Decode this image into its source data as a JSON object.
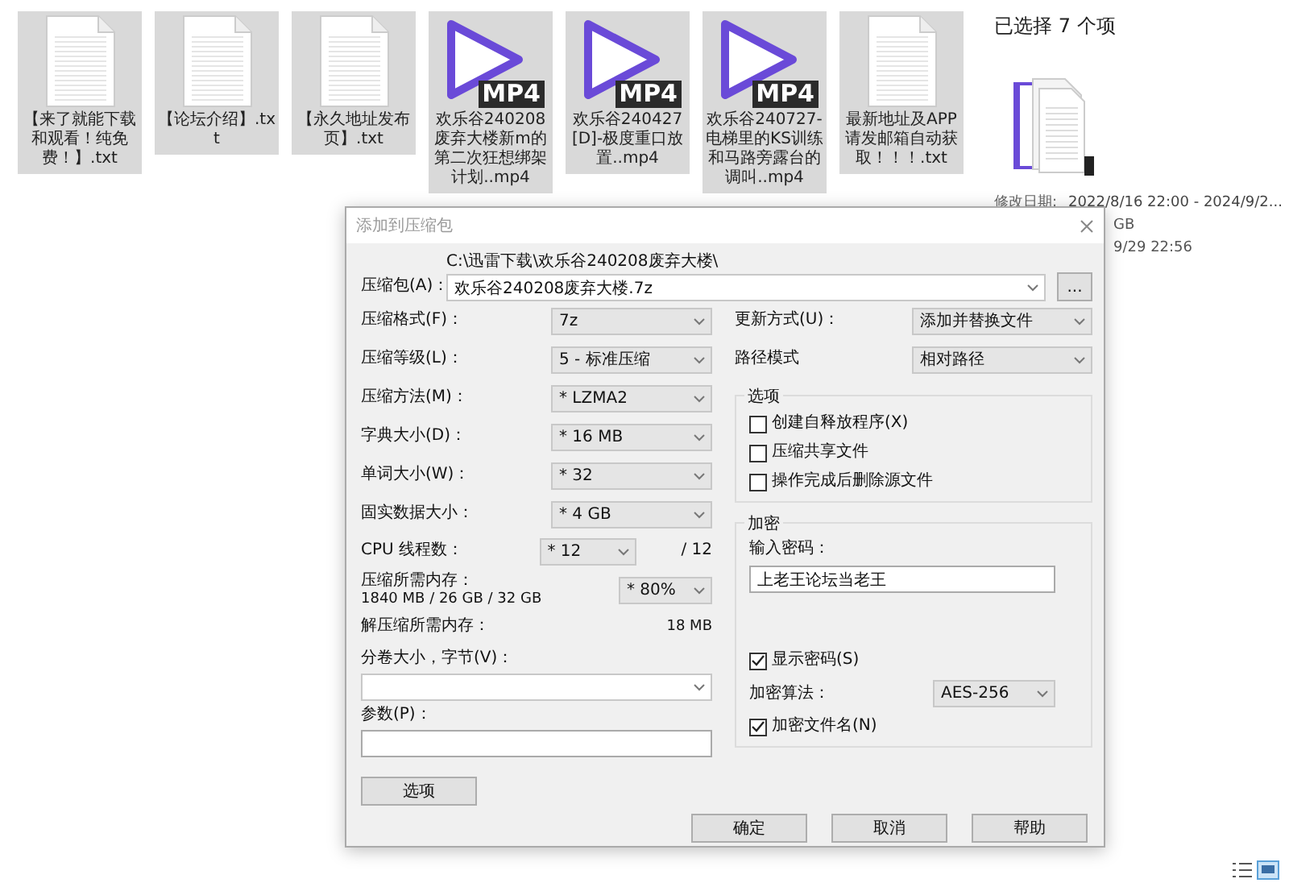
{
  "files": [
    {
      "name": "【来了就能下载和观看！纯免费！】.txt",
      "kind": "text",
      "selected": true
    },
    {
      "name": "【论坛介绍】.txt",
      "kind": "text",
      "selected": true
    },
    {
      "name": "【永久地址发布页】.txt",
      "kind": "text",
      "selected": true
    },
    {
      "name": "欢乐谷240208废弃大楼新m的第二次狂想绑架计划..mp4",
      "kind": "video",
      "badge": "MP4",
      "selected": true
    },
    {
      "name": "欢乐谷240427[D]-极度重口放置..mp4",
      "kind": "video",
      "badge": "MP4",
      "selected": true
    },
    {
      "name": "欢乐谷240727-电梯里的KS训练和马路旁露台的调叫..mp4",
      "kind": "video",
      "badge": "MP4",
      "selected": true
    },
    {
      "name": "最新地址及APP请发邮箱自动获取！！！.txt",
      "kind": "text",
      "selected": true
    }
  ],
  "details": {
    "title": "已选择 7 个项",
    "date_label": "修改日期:",
    "date_value": "2022/8/16 22:00 - 2024/9/2...",
    "line_2": "GB",
    "line_3": "9/29 22:56"
  },
  "dialog": {
    "title": "添加到压缩包",
    "archive": {
      "label": "压缩包(A)：",
      "path": "C:\\迅雷下载\\欢乐谷240208废弃大楼\\",
      "value": "欢乐谷240208废弃大楼.7z",
      "browse": "..."
    },
    "left_rows": [
      {
        "label": "压缩格式(F)：",
        "value": "7z"
      },
      {
        "label": "压缩等级(L)：",
        "value": "5 - 标准压缩"
      },
      {
        "label": "压缩方法(M)：",
        "value": "* LZMA2"
      },
      {
        "label": "字典大小(D)：",
        "value": "* 16 MB"
      },
      {
        "label": "单词大小(W)：",
        "value": "* 32"
      },
      {
        "label": "固实数据大小：",
        "value": "* 4 GB"
      }
    ],
    "threads": {
      "label": "CPU 线程数：",
      "value": "* 12",
      "max": "/ 12"
    },
    "memory": {
      "label": "压缩所需内存：",
      "detail": "1840 MB / 26 GB / 32 GB",
      "value": "* 80%"
    },
    "decompress": {
      "label": "解压缩所需内存：",
      "value": "18 MB"
    },
    "split": {
      "label": "分卷大小，字节(V)："
    },
    "params": {
      "label": "参数(P)："
    },
    "options_button": "选项",
    "right_rows": [
      {
        "label": "更新方式(U)：",
        "value": "添加并替换文件"
      },
      {
        "label": "路径模式",
        "value": "相对路径"
      }
    ],
    "options_group": {
      "title": "选项",
      "items": [
        {
          "label": "创建自释放程序(X)",
          "checked": false
        },
        {
          "label": "压缩共享文件",
          "checked": false
        },
        {
          "label": "操作完成后删除源文件",
          "checked": false
        }
      ]
    },
    "encryption": {
      "title": "加密",
      "password_label": "输入密码：",
      "password": "上老王论坛当老王",
      "show_password": {
        "label": "显示密码(S)",
        "checked": true
      },
      "method_label": "加密算法：",
      "method": "AES-256",
      "encrypt_names": {
        "label": "加密文件名(N)",
        "checked": true
      }
    },
    "buttons": [
      "确定",
      "取消",
      "帮助"
    ]
  }
}
